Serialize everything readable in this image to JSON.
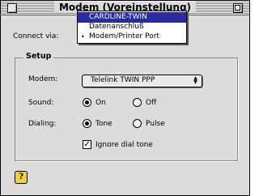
{
  "window": {
    "title": "Modem (Voreinstellung)"
  },
  "connect": {
    "label": "Connect via:",
    "menu": [
      {
        "label": "CARDLINE-TWIN",
        "highlighted": true,
        "checked": false
      },
      {
        "label": "Datenanschluß",
        "highlighted": false,
        "checked": false
      },
      {
        "label": "Modem/Printer Port",
        "highlighted": false,
        "checked": true
      }
    ],
    "check_mark": "•"
  },
  "setup": {
    "title": "Setup",
    "modem": {
      "label": "Modem:",
      "value": "Telelink TWIN PPP",
      "arrows": "▲▼"
    },
    "sound": {
      "label": "Sound:",
      "options": [
        "On",
        "Off"
      ],
      "selected": "On"
    },
    "dialing": {
      "label": "Dialing:",
      "options": [
        "Tone",
        "Pulse"
      ],
      "selected": "Tone"
    },
    "ignore_dial_tone": {
      "label": "Ignore dial tone",
      "checked": true,
      "mark": "✓"
    }
  },
  "help": {
    "icon": "help-icon",
    "glyph": "?"
  },
  "colors": {
    "window_bg": "#dcdcdc",
    "menu_highlight": "#2b2ba0",
    "help_icon": "#f2d23a"
  }
}
